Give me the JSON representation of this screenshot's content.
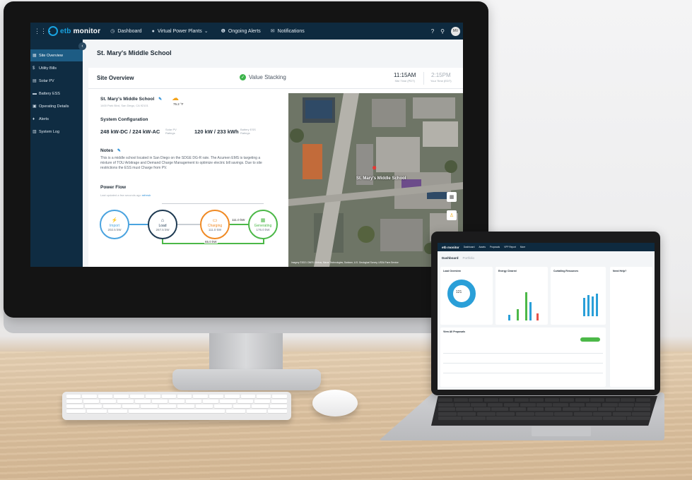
{
  "topnav": {
    "logo_prefix": "etb",
    "logo_suffix": " monitor",
    "items": [
      {
        "label": "Dashboard",
        "icon": "clock-icon"
      },
      {
        "label": "Virtual Power Plants",
        "icon": "globe-icon"
      },
      {
        "label": "Ongoing Alerts",
        "icon": "alert-icon"
      },
      {
        "label": "Notifications",
        "icon": "mail-icon"
      }
    ],
    "avatar": "MV"
  },
  "sidebar": {
    "items": [
      {
        "label": "Site Overview",
        "active": true
      },
      {
        "label": "Utility Bills"
      },
      {
        "label": "Solar PV"
      },
      {
        "label": "Battery ESS"
      },
      {
        "label": "Operating Details"
      },
      {
        "label": "Alerts"
      },
      {
        "label": "System Log"
      }
    ]
  },
  "page": {
    "title": "St. Mary's Middle School"
  },
  "overview": {
    "title": "Site Overview",
    "value_stacking": "Value Stacking",
    "site_time": "11:15AM",
    "site_time_label": "Site Time (PDT)",
    "your_time": "2:15PM",
    "your_time_label": "Your Time (EDT)",
    "site_name": "St. Mary's Middle School",
    "address": "1400 Park Blvd, San Diego, CA 92101",
    "weather_temp": "75.2 °F",
    "config_title": "System Configuration",
    "solar_value": "248 kW-DC / 224 kW-AC",
    "solar_label": "Solar PV Ratings",
    "battery_value": "120 kW / 233 kWh",
    "battery_label": "Battery ESS Ratings",
    "notes_title": "Notes",
    "notes_text": "This is a middle school located in San Diego on the SDGE DG-R rate. The Acumen EMS is targeting a mixture of TOU Arbitrage and Demand Charge Management to optimize electric bill savings. Due to site restrictions the ESS must Charge from PV.",
    "flow_title": "Power Flow",
    "updated": "Last updated a few seconds ago",
    "refresh": "refresh"
  },
  "power_flow": {
    "import": {
      "label": "Import",
      "value": "202.5 kW"
    },
    "load": {
      "label": "Load",
      "value": "267.5 kW"
    },
    "charging": {
      "label": "Charging",
      "value": "111.0 kW"
    },
    "generating": {
      "label": "Generating",
      "value": "176.0 kW"
    },
    "gen_to_charge": "111.0 kW",
    "gen_to_load": "65.0 kW"
  },
  "map": {
    "label": "St. Mary's Middle School",
    "attribution": "Imagery ©2021 CNES / Airbus, Maxar Technologies, Sanborn, U.S. Geological Survey, USDA Farm Service"
  },
  "laptop": {
    "logo": "etb monitor",
    "nav": [
      "Dashboard",
      "Assets",
      "Proposals",
      "VPP Report",
      "More"
    ],
    "title": "Dashboard",
    "subtitle": "Portfolio",
    "card1_title": "Load Overview",
    "card1_value": "121",
    "card2_title": "Energy Cleared",
    "card3_title": "Curtailing Resources",
    "card4_title": "Need Help?",
    "table_title": "View All Proposals"
  },
  "colors": {
    "nav_bg": "#0e2a3f",
    "accent": "#2b8fd8",
    "import": "#4aa3df",
    "load": "#1e3a52",
    "charging": "#f08a24",
    "generating": "#4cb848",
    "success": "#3cb44b"
  }
}
